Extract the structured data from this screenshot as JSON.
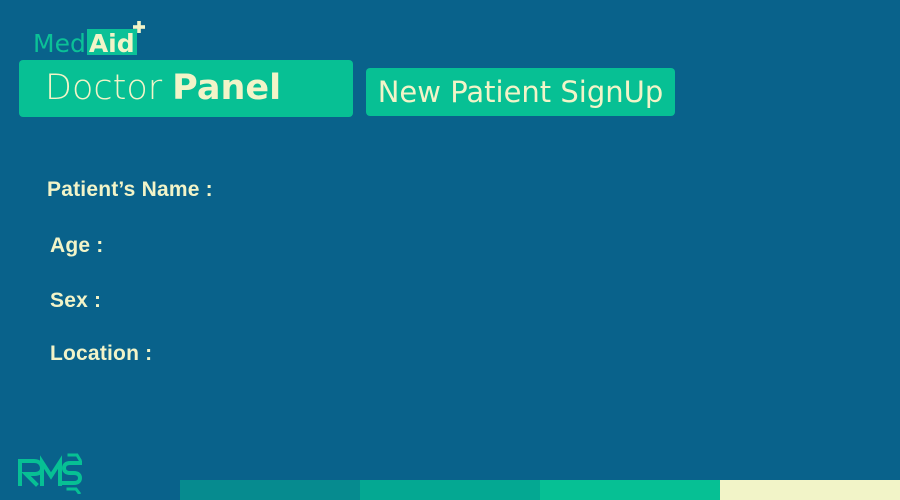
{
  "app": {
    "logo": {
      "med": "Med",
      "aid": "Aid",
      "plus_icon": "plus-icon"
    }
  },
  "header": {
    "panel_title_part1": "Doctor",
    "panel_title_part2": "Panel",
    "signup_button_label": "New Patient SignUp"
  },
  "form": {
    "fields": [
      {
        "label": "Patient’s Name :"
      },
      {
        "label": "Age :"
      },
      {
        "label": "Sex :"
      },
      {
        "label": "Location :"
      }
    ]
  },
  "footer": {
    "brand_logo": "rms-logo",
    "stripe_colors": [
      "#068b8f",
      "#04a892",
      "#06c094",
      "#f2f4c8"
    ]
  },
  "colors": {
    "background": "#09628b",
    "accent": "#07c094",
    "text_light": "#f2f4c8"
  }
}
